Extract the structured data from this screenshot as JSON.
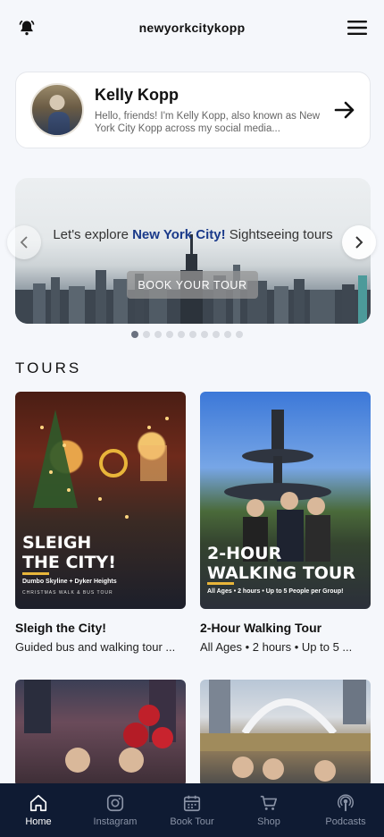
{
  "header": {
    "title": "newyorkcitykopp",
    "left_icon": "bell-icon",
    "right_icon": "menu-icon"
  },
  "profile": {
    "name": "Kelly Kopp",
    "description": "Hello, friends! I'm Kelly Kopp, also known as New York City Kopp across my social media...",
    "arrow_icon": "arrow-right-icon"
  },
  "banner": {
    "text_before": "Let's explore ",
    "text_highlight": "New York  City!",
    "text_after": " Sightseeing tours",
    "button_label": "BOOK YOUR TOUR",
    "slides_total": 10,
    "active_slide": 1
  },
  "tours": {
    "section_title": "TOURS",
    "items": [
      {
        "name": "Sleigh the City!",
        "description": "Guided bus and walking tour ...",
        "overlay_title_line1": "SLEIGH",
        "overlay_title_line2": "THE CITY!",
        "overlay_subtitle": "Dumbo Skyline + Dyker Heights",
        "overlay_subtitle2": "CHRISTMAS WALK & BUS TOUR"
      },
      {
        "name": "2-Hour Walking Tour",
        "description": "All Ages • 2 hours • Up to 5 ...",
        "overlay_title_line1": "2-HOUR",
        "overlay_title_line2": "WALKING TOUR",
        "overlay_subtitle": "All Ages • 2 hours • Up to 5 People per Group!"
      }
    ]
  },
  "bottom_nav": {
    "items": [
      {
        "label": "Home",
        "icon": "home-icon",
        "active": true
      },
      {
        "label": "Instagram",
        "icon": "instagram-icon",
        "active": false
      },
      {
        "label": "Book Tour",
        "icon": "calendar-icon",
        "active": false
      },
      {
        "label": "Shop",
        "icon": "cart-icon",
        "active": false
      },
      {
        "label": "Podcasts",
        "icon": "podcast-icon",
        "active": false
      }
    ]
  },
  "colors": {
    "nav_bg": "#0f1b33",
    "accent": "#1a3a8a",
    "page_bg": "#f5f7fb"
  }
}
